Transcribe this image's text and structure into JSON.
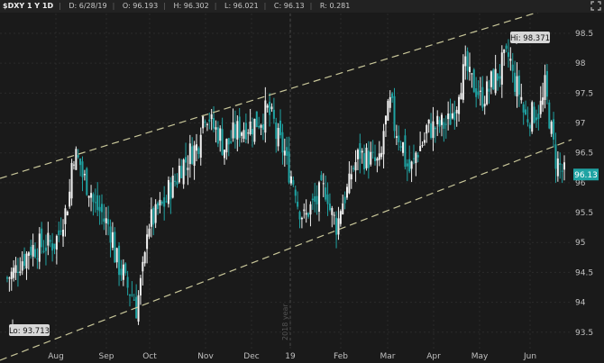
{
  "header": {
    "symbol": "$DXY 1 Y 1D",
    "date": "D: 6/28/19",
    "open": "O: 96.193",
    "high": "H: 96.302",
    "low": "L: 96.021",
    "close": "C: 96.13",
    "range": "R: 0.281"
  },
  "icons": {
    "expand": "expand-icon"
  },
  "colors": {
    "background": "#1a1a1a",
    "up": "#f2f2f2",
    "down": "#1fa3a3",
    "channel": "#c9c79a",
    "price_tag": "#1fa3a3"
  },
  "chart_data": {
    "type": "candlestick",
    "title": "$DXY 1 Y 1D",
    "ylim": [
      93.3,
      98.8
    ],
    "y_ticks": [
      "93.5",
      "94",
      "94.5",
      "95",
      "95.5",
      "96",
      "96.5",
      "97",
      "97.5",
      "98",
      "98.5"
    ],
    "x_ticks": [
      "Aug",
      "Sep",
      "Oct",
      "Nov",
      "Dec",
      "19",
      "Feb",
      "Mar",
      "Apr",
      "May",
      "Jun"
    ],
    "year_marker": "2018 year",
    "hi_label": "Hi: 98.371",
    "lo_label": "Lo: 93.713",
    "last_price": "96.13",
    "grid": true,
    "close_series": [
      {
        "date": "2018-07-02",
        "close": 94.4
      },
      {
        "date": "2018-07-16",
        "close": 94.9
      },
      {
        "date": "2018-08-01",
        "close": 95.0
      },
      {
        "date": "2018-08-08",
        "close": 95.5
      },
      {
        "date": "2018-08-14",
        "close": 96.5
      },
      {
        "date": "2018-08-28",
        "close": 95.6
      },
      {
        "date": "2018-09-05",
        "close": 95.3
      },
      {
        "date": "2018-09-12",
        "close": 94.6
      },
      {
        "date": "2018-09-24",
        "close": 93.9
      },
      {
        "date": "2018-10-01",
        "close": 95.3
      },
      {
        "date": "2018-10-10",
        "close": 95.6
      },
      {
        "date": "2018-10-23",
        "close": 96.3
      },
      {
        "date": "2018-11-01",
        "close": 96.6
      },
      {
        "date": "2018-11-07",
        "close": 97.2
      },
      {
        "date": "2018-11-20",
        "close": 96.6
      },
      {
        "date": "2018-11-29",
        "close": 96.9
      },
      {
        "date": "2018-12-10",
        "close": 97.0
      },
      {
        "date": "2018-12-18",
        "close": 97.2
      },
      {
        "date": "2018-12-31",
        "close": 96.3
      },
      {
        "date": "2019-01-10",
        "close": 95.4
      },
      {
        "date": "2019-01-24",
        "close": 95.9
      },
      {
        "date": "2019-01-31",
        "close": 95.3
      },
      {
        "date": "2019-02-15",
        "close": 96.5
      },
      {
        "date": "2019-02-28",
        "close": 96.3
      },
      {
        "date": "2019-03-07",
        "close": 97.3
      },
      {
        "date": "2019-03-20",
        "close": 96.2
      },
      {
        "date": "2019-04-01",
        "close": 96.9
      },
      {
        "date": "2019-04-15",
        "close": 97.0
      },
      {
        "date": "2019-04-25",
        "close": 97.9
      },
      {
        "date": "2019-05-06",
        "close": 97.4
      },
      {
        "date": "2019-05-16",
        "close": 97.8
      },
      {
        "date": "2019-05-23",
        "close": 98.1
      },
      {
        "date": "2019-06-04",
        "close": 97.1
      },
      {
        "date": "2019-06-12",
        "close": 97.2
      },
      {
        "date": "2019-06-17",
        "close": 97.6
      },
      {
        "date": "2019-06-21",
        "close": 96.6
      },
      {
        "date": "2019-06-28",
        "close": 96.13
      }
    ]
  }
}
